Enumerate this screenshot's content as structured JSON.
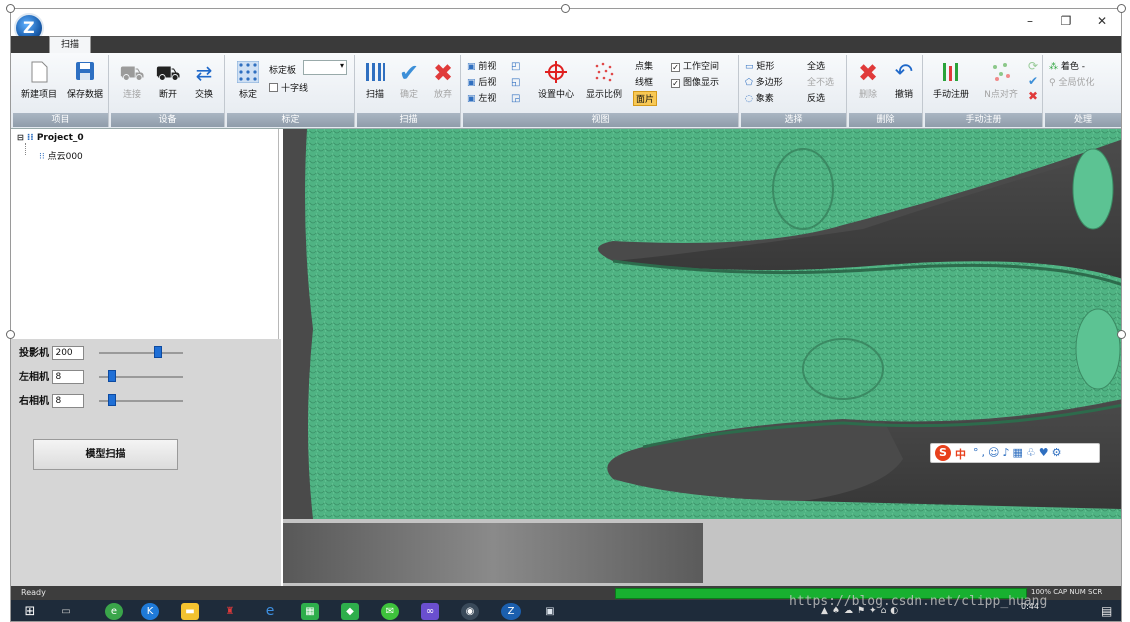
{
  "window": {
    "logo_letter": "Z",
    "minimize": "–",
    "restore": "❐",
    "close": "✕"
  },
  "tabs": [
    {
      "label": "扫描"
    }
  ],
  "ribbon": {
    "project": {
      "label": "项目",
      "new": "新建项目",
      "save": "保存数据"
    },
    "device": {
      "label": "设备",
      "connect": "连接",
      "disconnect": "断开",
      "exchange": "交换"
    },
    "calib": {
      "label": "标定",
      "calibrate": "标定",
      "board": "标定板",
      "crosshair": "十字线"
    },
    "scan": {
      "label": "扫描",
      "scan": "扫描",
      "confirm": "确定",
      "discard": "放弃"
    },
    "view": {
      "label": "视图",
      "front": "前视",
      "back": "后视",
      "left": "左视",
      "set_center": "设置中心",
      "display_ratio": "显示比例",
      "point_set": "点集",
      "wireframe": "线框",
      "facet": "面片",
      "workspace": "工作空间",
      "image_display": "图像显示"
    },
    "select": {
      "label": "选择",
      "rect": "矩形",
      "polygon": "多边形",
      "pixel": "象素",
      "select_all": "全选",
      "select_none": "全不选",
      "invert": "反选"
    },
    "delete": {
      "label": "删除",
      "delete": "删除",
      "undo": "撤销"
    },
    "manual_reg": {
      "label": "手动注册",
      "manual_reg": "手动注册",
      "n_point_align": "N点对齐"
    },
    "process": {
      "label": "处理",
      "coloring": "着色 -",
      "global_opt": "全局优化"
    }
  },
  "tree": {
    "root": "Project_0",
    "child": "点云000"
  },
  "controls": {
    "projector": {
      "label": "投影机",
      "value": "200",
      "level": 0.72
    },
    "left_cam": {
      "label": "左相机",
      "value": "8",
      "level": 0.12
    },
    "right_cam": {
      "label": "右相机",
      "value": "8",
      "level": 0.12
    },
    "model_scan": "模型扫描"
  },
  "status": {
    "text": "Ready",
    "progress": 1.0,
    "indicators": [
      "100%",
      "CAP",
      "NUM",
      "SCR"
    ],
    "clock": "0:44"
  },
  "watermark": "https://blog.csdn.net/clipp_huang",
  "ime": {
    "logo": "S",
    "cn": "中"
  },
  "colors": {
    "mesh": "#4fb383",
    "progress": "#18b030",
    "ribbon_label": "#8f9caa"
  }
}
